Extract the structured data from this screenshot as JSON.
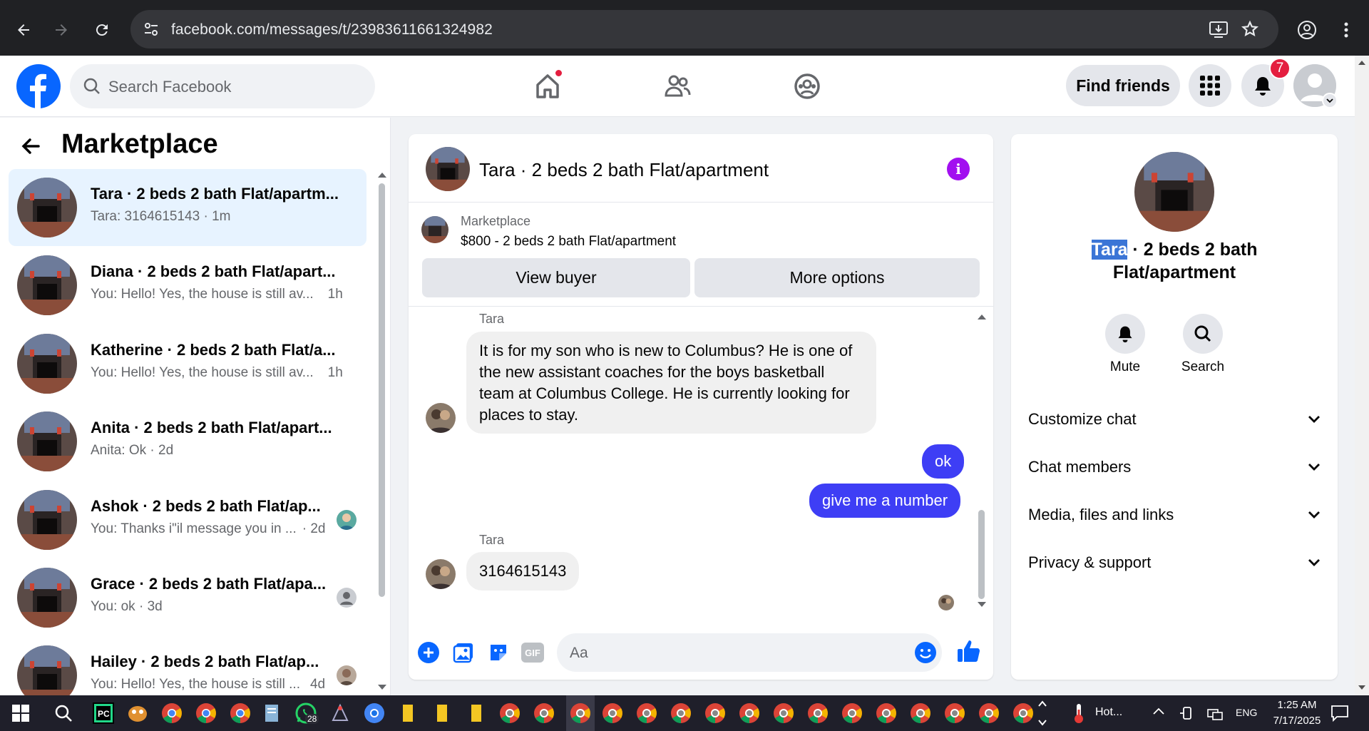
{
  "browser": {
    "url": "facebook.com/messages/t/23983611661324982"
  },
  "header": {
    "search_placeholder": "Search Facebook",
    "find_friends_label": "Find friends",
    "notification_count": "7"
  },
  "sidebar": {
    "title": "Marketplace",
    "conversations": [
      {
        "name": "Tara · 2 beds 2 bath Flat/apartm...",
        "preview": "Tara: 3164615143 · 1m",
        "active": true
      },
      {
        "name": "Diana · 2 beds 2 bath Flat/apart...",
        "preview": "You: Hello! Yes, the house is still av...",
        "time": "1h"
      },
      {
        "name": "Katherine · 2 beds 2 bath Flat/a...",
        "preview": "You: Hello! Yes, the house is still av...",
        "time": "1h"
      },
      {
        "name": "Anita · 2 beds 2 bath Flat/apart...",
        "preview": "Anita: Ok · 2d"
      },
      {
        "name": "Ashok · 2 beds 2 bath Flat/ap...",
        "preview": "You: Thanks i\"il message you in ...",
        "time": "· 2d"
      },
      {
        "name": "Grace · 2 beds 2 bath Flat/apa...",
        "preview": "You: ok · 3d"
      },
      {
        "name": "Hailey · 2 beds 2 bath Flat/ap...",
        "preview": "You: Hello! Yes, the house is still ...",
        "time": "4d"
      }
    ]
  },
  "chat": {
    "title": "Tara · 2 beds 2 bath Flat/apartment",
    "listing_source": "Marketplace",
    "listing_title": "$800 - 2 beds 2 bath Flat/apartment",
    "view_buyer_label": "View buyer",
    "more_options_label": "More options",
    "messages": [
      {
        "sender": "Tara",
        "text": "It is for my son who is new to Columbus? He is one of the new assistant coaches for the boys basketball team at Columbus College. He is currently looking for places to stay."
      },
      {
        "from_me": true,
        "text": "ok"
      },
      {
        "from_me": true,
        "text": "give me a number"
      },
      {
        "sender": "Tara",
        "text": "3164615143"
      }
    ],
    "composer_placeholder": "Aa"
  },
  "details": {
    "title_highlight": "Tara",
    "title_rest": " · 2 beds 2 bath Flat/apartment",
    "mute_label": "Mute",
    "search_label": "Search",
    "sections": [
      "Customize chat",
      "Chat members",
      "Media, files and links",
      "Privacy & support"
    ]
  },
  "taskbar": {
    "whatsapp_badge": "28",
    "weather_text": "Hot...",
    "language": "ENG",
    "time": "1:25 AM",
    "date": "7/17/2025"
  },
  "colors": {
    "fb_blue": "#0866ff",
    "outgoing_bubble": "#3e3ef5",
    "info_purple": "#a20ff0",
    "active_conversation": "#e7f3ff"
  }
}
